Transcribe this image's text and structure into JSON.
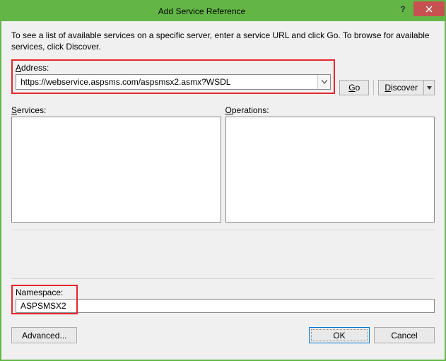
{
  "window": {
    "title": "Add Service Reference"
  },
  "instructions": "To see a list of available services on a specific server, enter a service URL and click Go. To browse for available services, click Discover.",
  "address": {
    "label": "Address:",
    "value": "https://webservice.aspsms.com/aspsmsx2.asmx?WSDL",
    "go": "Go",
    "discover": "Discover"
  },
  "lists": {
    "services_label": "Services:",
    "operations_label": "Operations:"
  },
  "namespace": {
    "label": "Namespace:",
    "value": "ASPSMSX2"
  },
  "footer": {
    "advanced": "Advanced...",
    "ok": "OK",
    "cancel": "Cancel"
  }
}
